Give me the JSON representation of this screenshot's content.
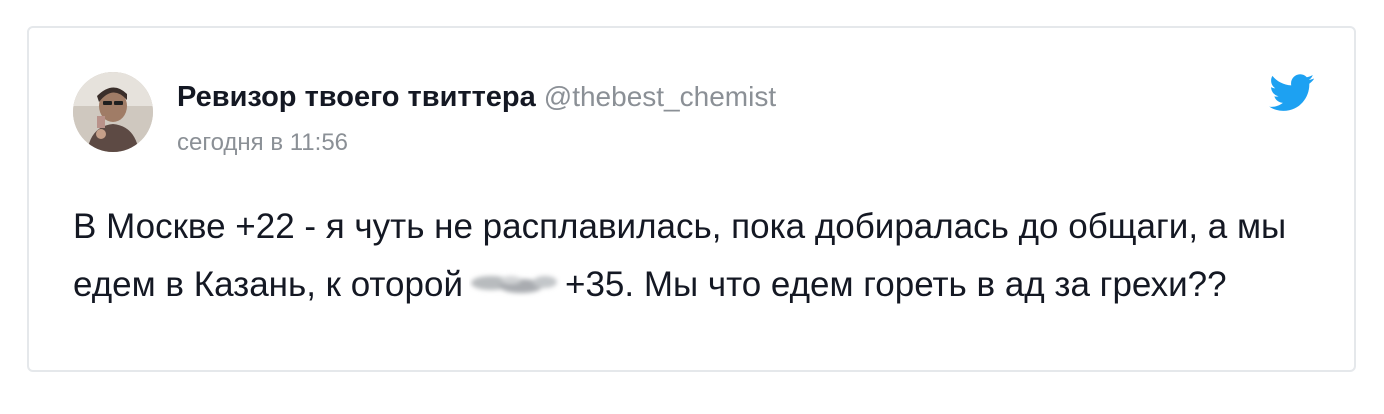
{
  "tweet": {
    "display_name": "Ревизор твоего твиттера",
    "handle": "@thebest_chemist",
    "timestamp": "сегодня в 11:56",
    "text_part1": "В Москве +22 - я чуть не расплавилась, пока добиралась до общаги, а мы едем в Казань, к оторой",
    "text_part2": "+35. Мы что едем гореть в ад за грехи??"
  },
  "icons": {
    "brand": "twitter-bird-icon",
    "avatar": "user-avatar"
  },
  "colors": {
    "twitter_blue": "#1da1f2",
    "text": "#141823",
    "muted": "#8b9096",
    "border": "#e5e8eb"
  }
}
